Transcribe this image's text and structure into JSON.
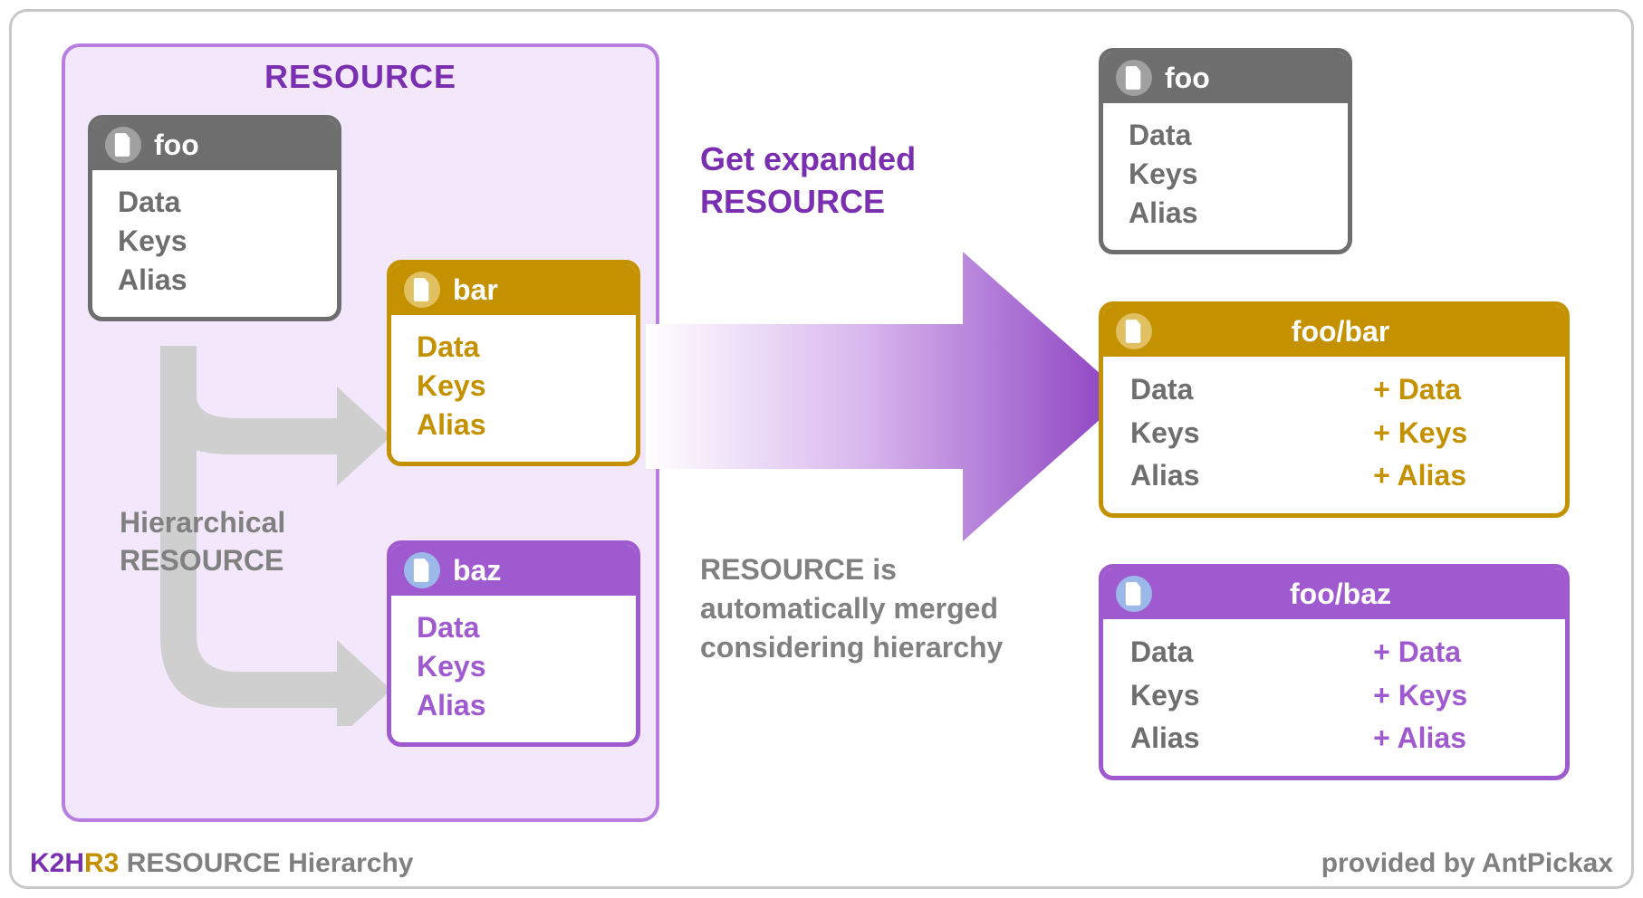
{
  "panel": {
    "title": "RESOURCE"
  },
  "cards": {
    "foo": {
      "name": "foo",
      "lines": {
        "l1": "Data",
        "l2": "Keys",
        "l3": "Alias"
      }
    },
    "bar": {
      "name": "bar",
      "lines": {
        "l1": "Data",
        "l2": "Keys",
        "l3": "Alias"
      }
    },
    "baz": {
      "name": "baz",
      "lines": {
        "l1": "Data",
        "l2": "Keys",
        "l3": "Alias"
      }
    },
    "foo_r": {
      "name": "foo",
      "lines": {
        "l1": "Data",
        "l2": "Keys",
        "l3": "Alias"
      }
    },
    "foobar": {
      "name": "foo/bar",
      "rows": {
        "r1": {
          "a": "Data",
          "plus": "+ Data"
        },
        "r2": {
          "a": "Keys",
          "plus": "+ Keys"
        },
        "r3": {
          "a": "Alias",
          "plus": "+ Alias"
        }
      }
    },
    "foobaz": {
      "name": "foo/baz",
      "rows": {
        "r1": {
          "a": "Data",
          "plus": "+ Data"
        },
        "r2": {
          "a": "Keys",
          "plus": "+ Keys"
        },
        "r3": {
          "a": "Alias",
          "plus": "+ Alias"
        }
      }
    }
  },
  "labels": {
    "hierarchical_l1": "Hierarchical",
    "hierarchical_l2": "RESOURCE",
    "get_expanded_l1": "Get expanded",
    "get_expanded_l2": "RESOURCE",
    "auto_l1": "RESOURCE is",
    "auto_l2": "automatically merged",
    "auto_l3": "considering hierarchy"
  },
  "footer": {
    "brand_k2h": "K2H",
    "brand_r3": "R3",
    "rest": " RESOURCE Hierarchy",
    "provider": "provided by AntPickax"
  }
}
